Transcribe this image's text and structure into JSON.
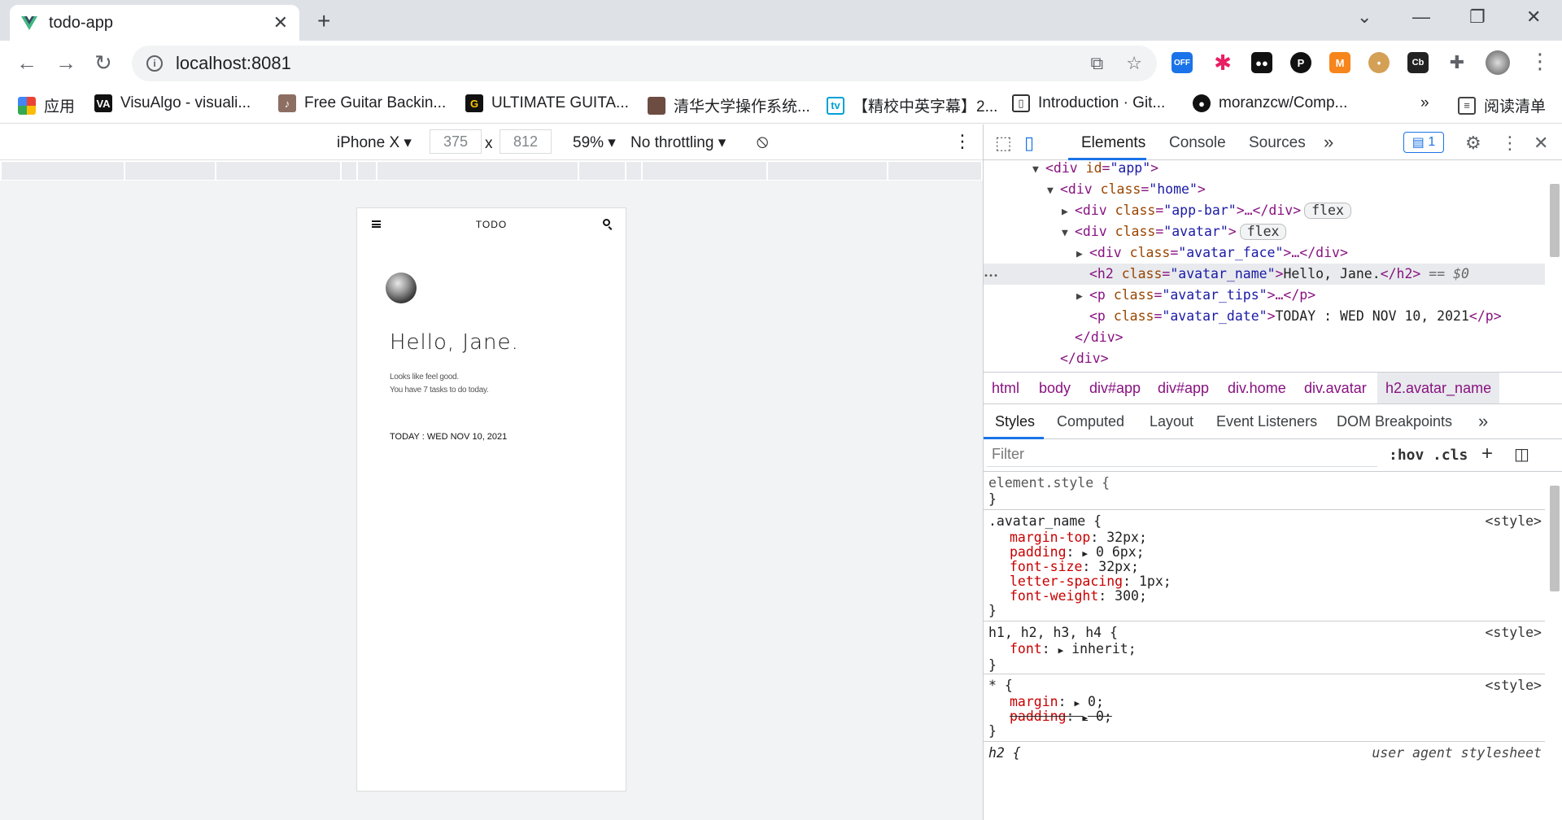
{
  "browser": {
    "tab_title": "todo-app",
    "url": "localhost:8081",
    "new_tab_symbol": "+",
    "close_symbol": "✕",
    "window_controls": [
      "⌄",
      "—",
      "❐",
      "✕"
    ],
    "extensions": [
      "translate-icon",
      "bookmark-star-icon",
      "off-extension-icon",
      "asterisk-extension-icon",
      "panda-extension-icon",
      "metamask-icon",
      "cookie-icon",
      "cb-extension-icon",
      "puzzle-icon",
      "profile-avatar"
    ],
    "off_badge": "OFF",
    "cb_badge": "Cb",
    "bookmarks": [
      {
        "label": "应用",
        "icon": "apps-grid-icon"
      },
      {
        "label": "VisuAlgo - visuali...",
        "icon": "visualgo-icon"
      },
      {
        "label": "Free Guitar Backin...",
        "icon": "guitar-icon"
      },
      {
        "label": "ULTIMATE GUITA...",
        "icon": "ultimate-guitar-icon"
      },
      {
        "label": "清华大学操作系统...",
        "icon": "thumbnail-icon"
      },
      {
        "label": "【精校中英字幕】2...",
        "icon": "bilibili-icon"
      },
      {
        "label": "Introduction · Git...",
        "icon": "book-icon"
      },
      {
        "label": "moranzcw/Comp...",
        "icon": "github-icon"
      }
    ],
    "bookmarks_more": "»",
    "reading_list": "阅读清单"
  },
  "device_toolbar": {
    "device": "iPhone X",
    "width": "375",
    "times": "x",
    "height": "812",
    "zoom": "59%",
    "throttling": "No throttling"
  },
  "app": {
    "title": "TODO",
    "greeting": "Hello, Jane.",
    "tips_line1": "Looks like feel good.",
    "tips_line2": "You have 7 tasks to do today.",
    "date": "TODAY : WED NOV 10, 2021"
  },
  "devtools": {
    "tabs": [
      "Elements",
      "Console",
      "Sources"
    ],
    "more": "»",
    "issues_count": "1",
    "elements_tree": {
      "l1_tag": "<div ",
      "l1_attr": "id",
      "l1_val": "\"app\"",
      "l1_end": ">",
      "l2_tag": "<div ",
      "l2_attr": "class",
      "l2_val": "\"home\"",
      "l2_end": ">",
      "l3_tag": "<div ",
      "l3_attr": "class",
      "l3_val": "\"app-bar\"",
      "l3_end": ">…</div>",
      "l3_pill": "flex",
      "l4_tag": "<div ",
      "l4_attr": "class",
      "l4_val": "\"avatar\"",
      "l4_end": ">",
      "l4_pill": "flex",
      "l5_tag": "<div ",
      "l5_attr": "class",
      "l5_val": "\"avatar_face\"",
      "l5_end": ">…</div>",
      "l6_tag": "<h2 ",
      "l6_attr": "class",
      "l6_val": "\"avatar_name\"",
      "l6_text": "Hello, Jane.",
      "l6_close": "</h2>",
      "l6_eq": " == $0",
      "l7_tag": "<p ",
      "l7_attr": "class",
      "l7_val": "\"avatar_tips\"",
      "l7_end": ">…</p>",
      "l8_tag": "<p ",
      "l8_attr": "class",
      "l8_val": "\"avatar_date\"",
      "l8_text": "TODAY : WED NOV 10, 2021",
      "l8_close": "</p>",
      "l9": "</div>",
      "l10": "</div>",
      "ellipsis": "•••"
    },
    "breadcrumbs": [
      "html",
      "body",
      "div#app",
      "div#app",
      "div.home",
      "div.avatar",
      "h2.avatar_name"
    ],
    "sub_tabs": [
      "Styles",
      "Computed",
      "Layout",
      "Event Listeners",
      "DOM Breakpoints"
    ],
    "filter_placeholder": "Filter",
    "hov": ":hov",
    "cls": ".cls",
    "plus": "+",
    "styles": {
      "element_style": "element.style {",
      "close": "}",
      "rule1_selector": ".avatar_name {",
      "rule1_source": "<style>",
      "rule1_props": [
        {
          "name": "margin-top",
          "value": "32px;"
        },
        {
          "name": "padding",
          "value": "0 6px;"
        },
        {
          "name": "font-size",
          "value": "32px;"
        },
        {
          "name": "letter-spacing",
          "value": "1px;"
        },
        {
          "name": "font-weight",
          "value": "300;"
        }
      ],
      "rule2_selector": "h1, h2, h3, h4 {",
      "rule2_source": "<style>",
      "rule2_prop": "font",
      "rule2_value": "inherit;",
      "rule3_selector": "* {",
      "rule3_source": "<style>",
      "rule3_prop1": "margin",
      "rule3_value1": "0;",
      "rule3_prop2": "padding",
      "rule3_value2": "0;",
      "rule4_selector": "h2 {",
      "rule4_source": "user agent stylesheet"
    }
  }
}
